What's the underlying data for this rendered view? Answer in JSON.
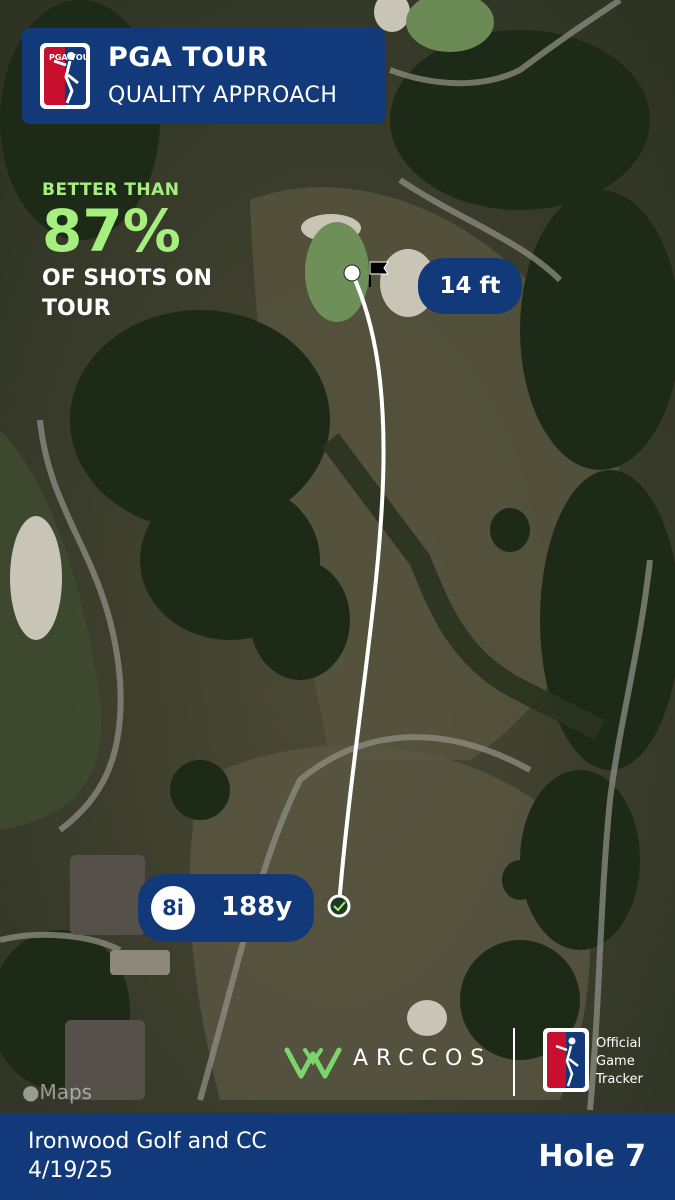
{
  "header": {
    "brand": "PGA TOUR",
    "subtitle": "QUALITY APPROACH",
    "logo_text": "PGA TOUR"
  },
  "stat": {
    "lead": "BETTER THAN",
    "percent": "87%",
    "tail": "OF SHOTS ON TOUR"
  },
  "shot": {
    "proximity": "14 ft",
    "club": "8i",
    "distance": "188y"
  },
  "branding": {
    "partner": "ARCCOS",
    "tracker_lines": [
      "Official",
      "Game",
      "Tracker"
    ]
  },
  "map": {
    "provider_credit": "Maps"
  },
  "footer": {
    "course": "Ironwood Golf and CC",
    "date": "4/19/25",
    "hole": "Hole 7"
  },
  "colors": {
    "accent_blue": "#123a7a",
    "highlight_green": "#a6ef7f"
  },
  "icons": [
    "pga-tour-logo-icon",
    "flag-icon",
    "arccos-crown-icon",
    "apple-logo-icon"
  ]
}
